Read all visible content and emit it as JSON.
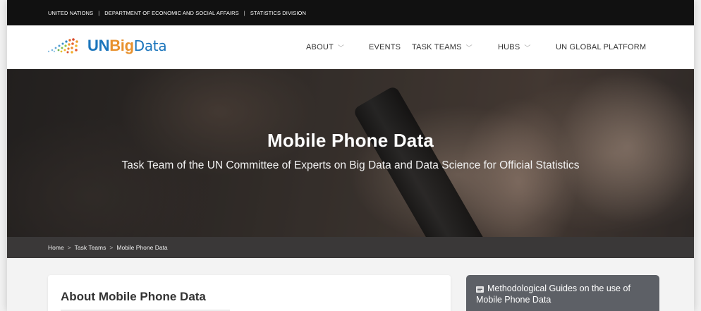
{
  "topbar": {
    "org": "UNITED NATIONS",
    "dept": "DEPARTMENT OF ECONOMIC AND SOCIAL AFFAIRS",
    "division": "STATISTICS DIVISION",
    "separator": "|"
  },
  "logo": {
    "un": "UN",
    "big": "Big",
    "data": "Data"
  },
  "nav": {
    "about": "ABOUT",
    "events": "EVENTS",
    "task_teams": "TASK TEAMS",
    "hubs": "HUBS",
    "global_platform": "UN GLOBAL PLATFORM",
    "chevron": "﹀"
  },
  "hero": {
    "title": "Mobile Phone Data",
    "subtitle": "Task Team of the UN Committee of Experts on Big Data and Data Science for Official Statistics"
  },
  "breadcrumb": {
    "items": [
      "Home",
      "Task Teams",
      "Mobile Phone Data"
    ],
    "separator": ">"
  },
  "main": {
    "card_title": "About Mobile Phone Data"
  },
  "sidebar": {
    "box_text": "Methodological Guides on the use of Mobile Phone Data",
    "icon": "document-icon"
  },
  "colors": {
    "brand_blue": "#1b75bc",
    "brand_orange": "#e8912d",
    "topbar_bg": "#111111",
    "breadcrumb_bg": "#3a3838",
    "side_box_bg": "#5d6066"
  }
}
